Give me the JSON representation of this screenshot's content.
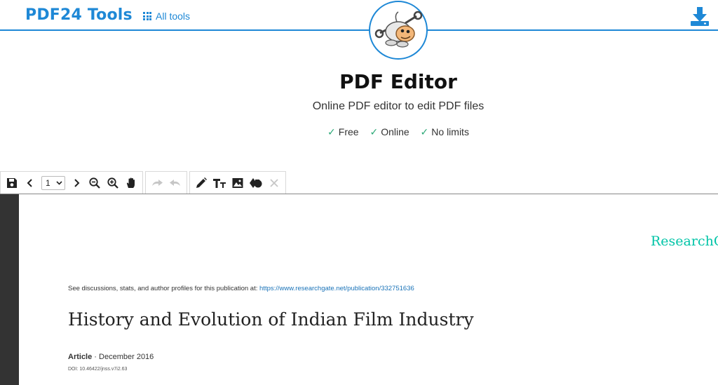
{
  "header": {
    "brand": "PDF24 Tools",
    "all_tools_label": "All tools"
  },
  "hero": {
    "title": "PDF Editor",
    "subtitle": "Online PDF editor to edit PDF files",
    "features": [
      "Free",
      "Online",
      "No limits"
    ]
  },
  "toolbar": {
    "page_value": "1"
  },
  "document": {
    "rg_logo": "ResearchG",
    "see_prefix": "See discussions, stats, and author profiles for this publication at: ",
    "see_link": "https://www.researchgate.net/publication/332751636",
    "title": "History and Evolution of Indian Film Industry",
    "article_label": "Article",
    "article_date": " · December 2016",
    "doi": "DOI: 10.46422/jnss.v7i2.63"
  },
  "colors": {
    "accent": "#1e88d6",
    "check": "#2aa876",
    "researchgate": "#00c4a7"
  }
}
